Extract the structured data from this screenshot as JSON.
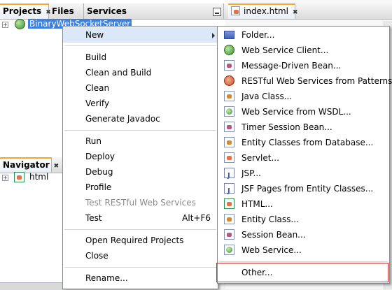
{
  "left_panel": {
    "tabs": [
      "Projects",
      "Files",
      "Services"
    ],
    "close_glyph": "✖",
    "project_name": "BinaryWebSocketServer"
  },
  "navigator": {
    "title": "Navigator",
    "close_glyph": "✖",
    "node": "html"
  },
  "editor": {
    "tab_label": "index.html",
    "close_glyph": "✖"
  },
  "context_menu": {
    "new": "New",
    "build": "Build",
    "clean_and_build": "Clean and Build",
    "clean": "Clean",
    "verify": "Verify",
    "generate_javadoc": "Generate Javadoc",
    "run": "Run",
    "deploy": "Deploy",
    "debug": "Debug",
    "profile": "Profile",
    "test_restful": "Test RESTful Web Services",
    "test": "Test",
    "test_shortcut": "Alt+F6",
    "open_required_projects": "Open Required Projects",
    "close": "Close",
    "rename": "Rename..."
  },
  "submenu": {
    "items": [
      {
        "label": "Folder...",
        "icon": "folder-icon"
      },
      {
        "label": "Web Service Client...",
        "icon": "web-service-client-icon"
      },
      {
        "label": "Message-Driven Bean...",
        "icon": "bean-icon"
      },
      {
        "label": "RESTful Web Services from Patterns...",
        "icon": "rest-icon"
      },
      {
        "label": "Java Class...",
        "icon": "java-class-icon"
      },
      {
        "label": "Web Service from WSDL...",
        "icon": "web-service-icon"
      },
      {
        "label": "Timer Session Bean...",
        "icon": "bean-icon"
      },
      {
        "label": "Entity Classes from Database...",
        "icon": "entity-icon"
      },
      {
        "label": "Servlet...",
        "icon": "servlet-icon"
      },
      {
        "label": "JSP...",
        "icon": "jsp-icon"
      },
      {
        "label": "JSF Pages from Entity Classes...",
        "icon": "jsf-icon"
      },
      {
        "label": "HTML...",
        "icon": "html-icon"
      },
      {
        "label": "Entity Class...",
        "icon": "entity-icon"
      },
      {
        "label": "Session Bean...",
        "icon": "bean-icon"
      },
      {
        "label": "Web Service...",
        "icon": "web-service-icon"
      },
      {
        "label": "Other...",
        "icon": "none"
      }
    ]
  },
  "colors": {
    "selection": "#3d80df",
    "menu_hover": "#c9dbf2",
    "highlight_box": "#cf2d2d",
    "active_tab_accent": "#f3a72b"
  }
}
